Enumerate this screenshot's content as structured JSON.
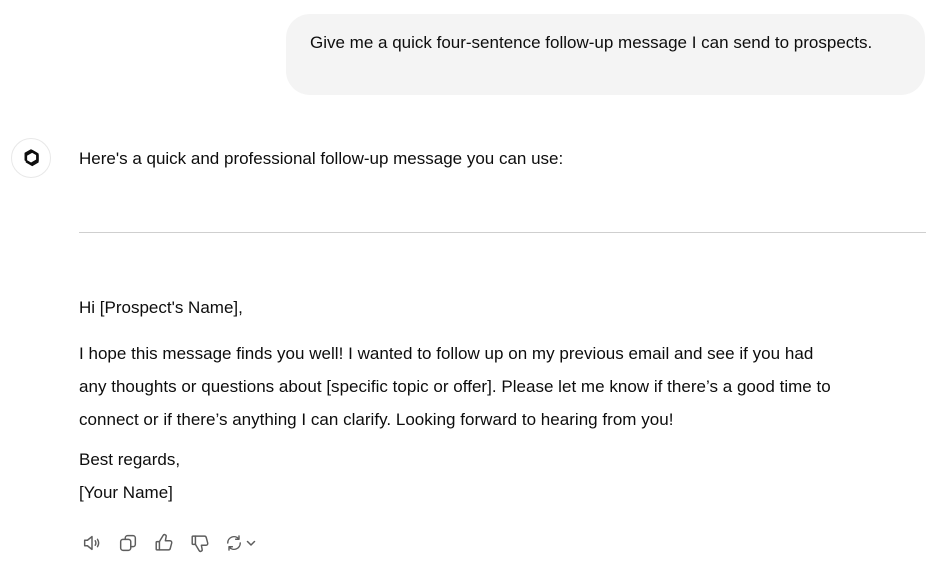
{
  "conversation": {
    "user_message": "Give me a quick four-sentence follow-up message I can send to prospects.",
    "assistant": {
      "avatar_icon": "openai-logo-icon",
      "intro": "Here's a quick and professional follow-up message you can use:",
      "draft": {
        "greeting": "Hi [Prospect's Name],",
        "body_lines": [
          "I hope this message finds you well! I wanted to follow up on my previous email and see if you had",
          "any thoughts or questions about [specific topic or offer]. Please let me know if there’s a good time to",
          "connect or if there’s anything I can clarify. Looking forward to hearing from you!"
        ],
        "signoff": "Best regards,",
        "signature": "[Your Name]"
      },
      "actions": [
        {
          "name": "read-aloud",
          "icon": "speaker-icon"
        },
        {
          "name": "copy",
          "icon": "copy-icon"
        },
        {
          "name": "good-response",
          "icon": "thumbs-up-icon"
        },
        {
          "name": "bad-response",
          "icon": "thumbs-down-icon"
        },
        {
          "name": "regenerate",
          "icon": "refresh-icon"
        }
      ]
    }
  },
  "colors": {
    "user_bubble_bg": "#f4f4f4",
    "text": "#0d0d0d",
    "icon": "#5d5d5d",
    "divider": "#cfcfcf"
  }
}
